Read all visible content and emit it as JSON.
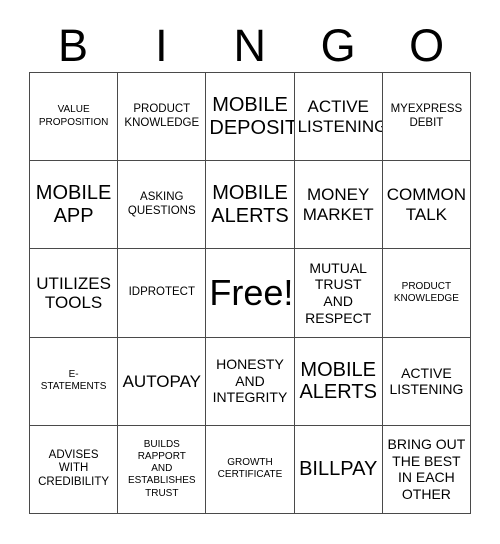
{
  "header": {
    "letters": [
      "B",
      "I",
      "N",
      "G",
      "O"
    ]
  },
  "grid": {
    "columns": 5,
    "rows": 5,
    "border_color": "#4a4a4a",
    "background_color": "#ffffff",
    "text_color": "#000000",
    "cells": [
      {
        "text": "VALUE\nPROPOSITION",
        "size": "xs"
      },
      {
        "text": "PRODUCT\nKNOWLEDGE",
        "size": "s"
      },
      {
        "text": "MOBILE\nDEPOSIT",
        "size": "xl"
      },
      {
        "text": "ACTIVE\nLISTENING",
        "size": "l"
      },
      {
        "text": "MYEXPRESS\nDEBIT",
        "size": "s"
      },
      {
        "text": "MOBILE\nAPP",
        "size": "xl"
      },
      {
        "text": "ASKING\nQUESTIONS",
        "size": "s"
      },
      {
        "text": "MOBILE\nALERTS",
        "size": "xl"
      },
      {
        "text": "MONEY\nMARKET",
        "size": "l"
      },
      {
        "text": "COMMON\nTALK",
        "size": "l"
      },
      {
        "text": "UTILIZES\nTOOLS",
        "size": "l"
      },
      {
        "text": "IDPROTECT",
        "size": "s"
      },
      {
        "text": "Free!",
        "size": "free"
      },
      {
        "text": "MUTUAL\nTRUST\nAND\nRESPECT",
        "size": "m"
      },
      {
        "text": "PRODUCT\nKNOWLEDGE",
        "size": "xs"
      },
      {
        "text": "E-\nSTATEMENTS",
        "size": "xs"
      },
      {
        "text": "AUTOPAY",
        "size": "l"
      },
      {
        "text": "HONESTY\nAND\nINTEGRITY",
        "size": "m"
      },
      {
        "text": "MOBILE\nALERTS",
        "size": "xl"
      },
      {
        "text": "ACTIVE\nLISTENING",
        "size": "m"
      },
      {
        "text": "ADVISES\nWITH\nCREDIBILITY",
        "size": "s"
      },
      {
        "text": "BUILDS\nRAPPORT\nAND\nESTABLISHES\nTRUST",
        "size": "xs"
      },
      {
        "text": "GROWTH\nCERTIFICATE",
        "size": "xs"
      },
      {
        "text": "BILLPAY",
        "size": "xl"
      },
      {
        "text": "BRING OUT\nTHE BEST\nIN EACH\nOTHER",
        "size": "m"
      }
    ]
  }
}
